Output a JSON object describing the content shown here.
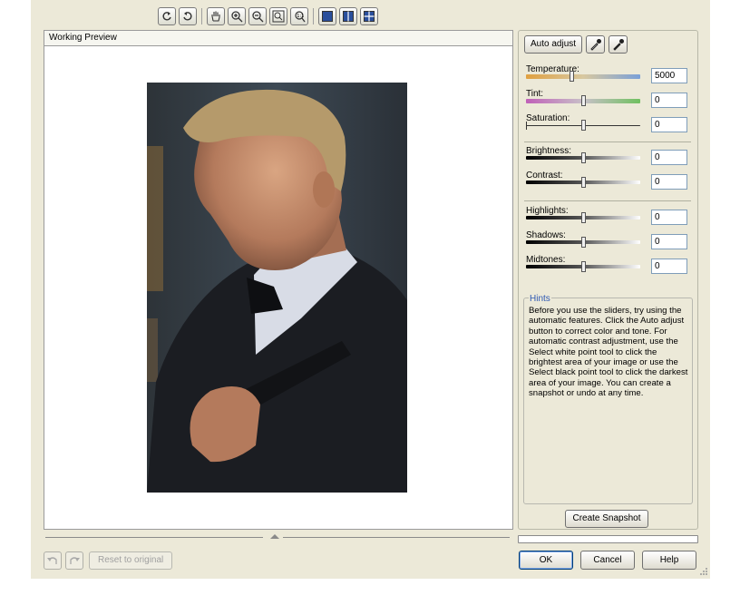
{
  "toolbar": {
    "buttons": [
      "rotate-left-icon",
      "rotate-right-icon",
      "pan-hand-icon",
      "zoom-in-icon",
      "zoom-out-icon",
      "zoom-fit-icon",
      "zoom-actual-icon",
      "single-view-icon",
      "split-view-icon",
      "quad-view-icon"
    ]
  },
  "preview": {
    "title": "Working Preview"
  },
  "panel": {
    "auto_adjust_label": "Auto adjust",
    "white_point_icon": "white-point-eyedropper-icon",
    "black_point_icon": "black-point-eyedropper-icon",
    "controls": [
      {
        "label": "Temperature:",
        "value": "5000",
        "level": 0.4
      },
      {
        "label": "Tint:",
        "value": "0",
        "level": 0.5
      },
      {
        "label": "Saturation:",
        "value": "0",
        "level": 0.5
      },
      {
        "label": "Brightness:",
        "value": "0",
        "level": 0.5
      },
      {
        "label": "Contrast:",
        "value": "0",
        "level": 0.5
      },
      {
        "label": "Highlights:",
        "value": "0",
        "level": 0.5
      },
      {
        "label": "Shadows:",
        "value": "0",
        "level": 0.5
      },
      {
        "label": "Midtones:",
        "value": "0",
        "level": 0.5
      }
    ],
    "hints_title": "Hints",
    "hints_text": "Before you use the sliders, try using the automatic features. Click the Auto adjust button to correct color and tone. For automatic contrast adjustment, use the Select white point tool to click the brightest area of your image or use the Select black point tool to click the darkest area of your image. You can create a snapshot or undo at any time.",
    "snapshot_label": "Create Snapshot"
  },
  "footer": {
    "reset_label": "Reset to original",
    "ok_label": "OK",
    "cancel_label": "Cancel",
    "help_label": "Help"
  },
  "colors": {
    "dialog_bg": "#ece9d8",
    "hints_title": "#2f59b3"
  }
}
